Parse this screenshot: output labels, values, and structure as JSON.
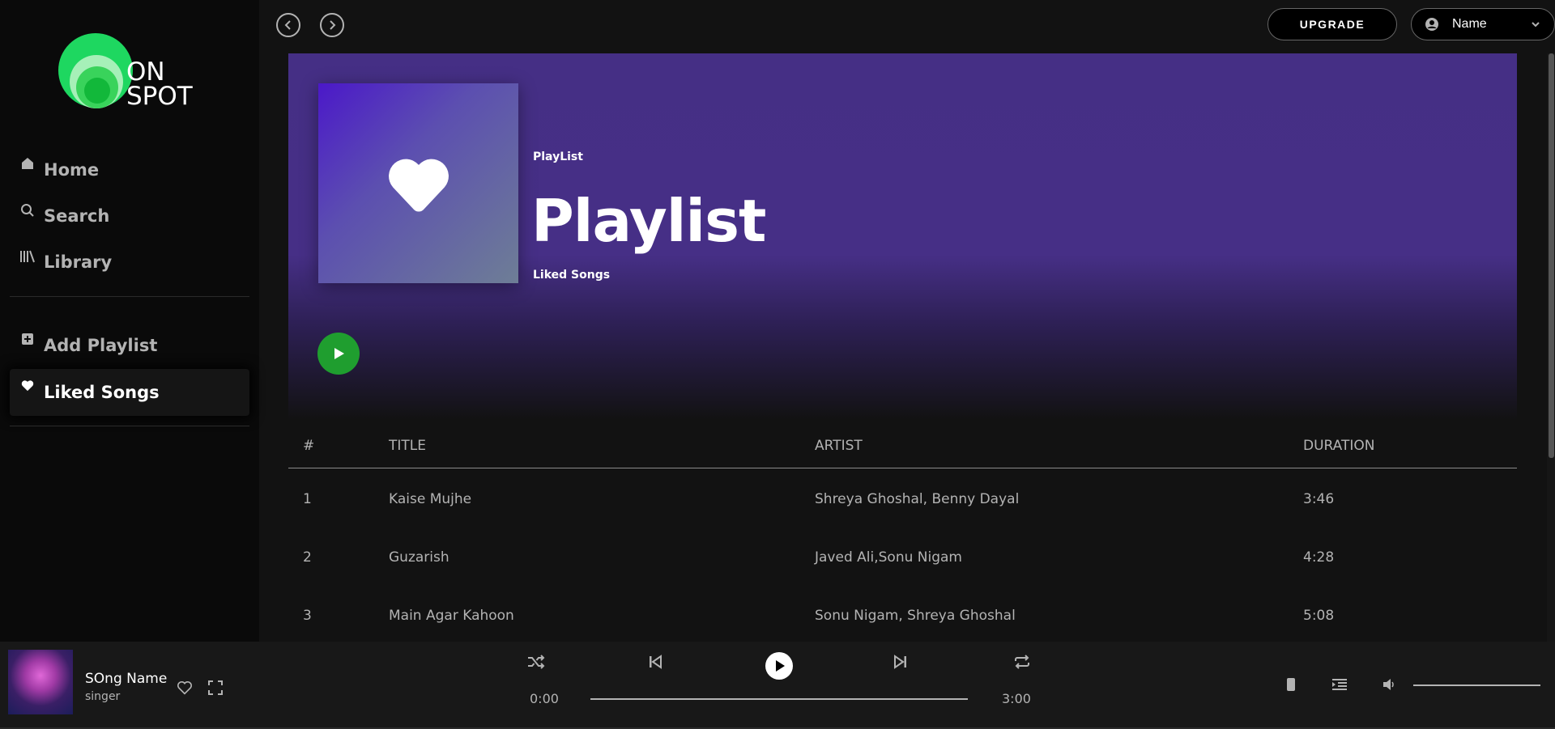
{
  "brand": {
    "line1": "ON",
    "line2": "SPOT",
    "accent": "#1ed760"
  },
  "sidebar": {
    "main": [
      {
        "label": "Home",
        "icon": "home-icon"
      },
      {
        "label": "Search",
        "icon": "search-icon"
      },
      {
        "label": "Library",
        "icon": "library-icon"
      }
    ],
    "library": [
      {
        "label": "Add Playlist",
        "icon": "add-box-icon"
      },
      {
        "label": "Liked Songs",
        "icon": "heart-icon",
        "active": true
      }
    ]
  },
  "topbar": {
    "upgrade_label": "UPGRADE",
    "user_name": "Name"
  },
  "hero": {
    "type": "PlayList",
    "title": "Playlist",
    "subtitle": "Liked Songs",
    "bg": "#452f85"
  },
  "table": {
    "headers": {
      "num": "#",
      "title": "TITLE",
      "artist": "ARTIST",
      "duration": "DURATION"
    },
    "rows": [
      {
        "num": "1",
        "title": "Kaise Mujhe",
        "artist": "Shreya Ghoshal, Benny Dayal",
        "duration": "3:46"
      },
      {
        "num": "2",
        "title": "Guzarish",
        "artist": "Javed Ali,Sonu Nigam",
        "duration": "4:28"
      },
      {
        "num": "3",
        "title": "Main Agar Kahoon",
        "artist": "Sonu Nigam, Shreya Ghoshal",
        "duration": "5:08"
      }
    ]
  },
  "player": {
    "song": "SOng Name",
    "artist": "singer",
    "elapsed": "0:00",
    "total": "3:00",
    "progress": 0,
    "volume": 1.0,
    "play_color": "#1f9e2f"
  }
}
